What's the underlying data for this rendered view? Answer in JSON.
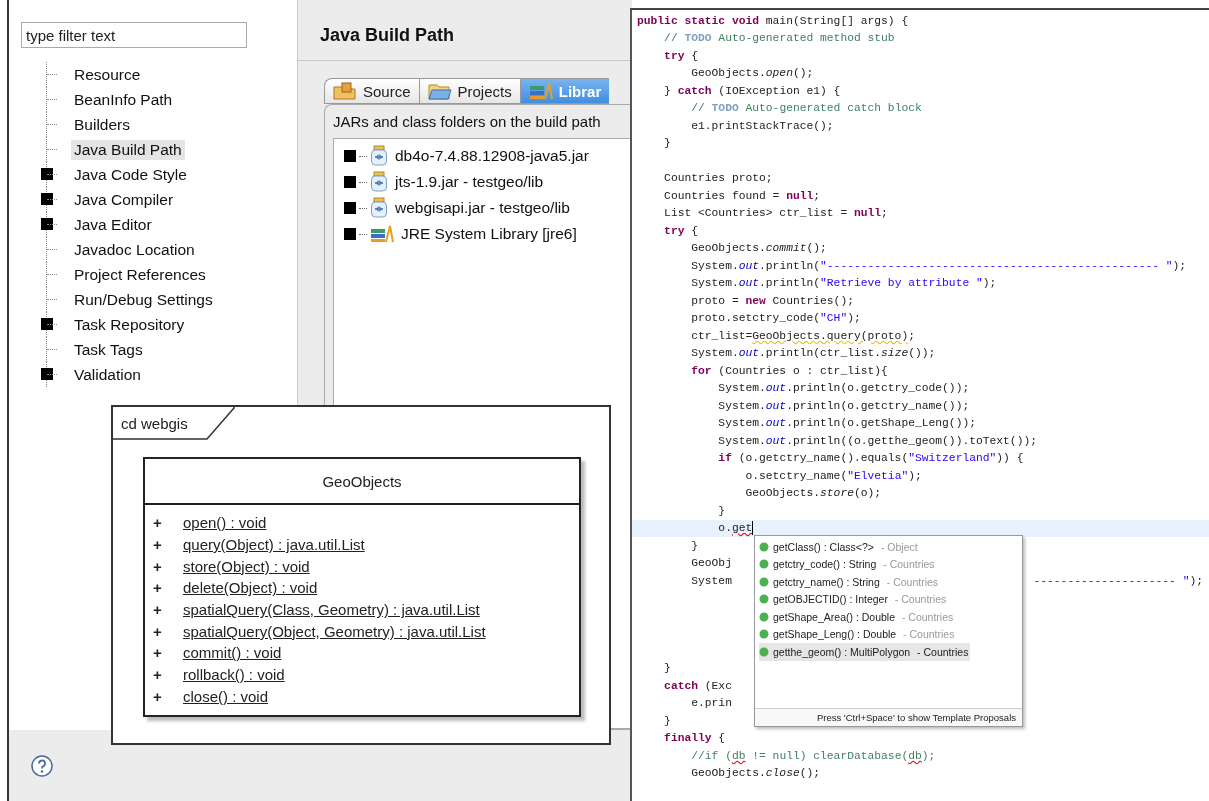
{
  "preferences": {
    "filter": {
      "placeholder": "type filter text"
    },
    "tree": [
      {
        "label": "Resource",
        "kind": "leaf",
        "selected": false
      },
      {
        "label": "BeanInfo Path",
        "kind": "leaf",
        "selected": false
      },
      {
        "label": "Builders",
        "kind": "leaf",
        "selected": false
      },
      {
        "label": "Java Build Path",
        "kind": "leaf",
        "selected": true
      },
      {
        "label": "Java Code Style",
        "kind": "folder",
        "selected": false
      },
      {
        "label": "Java Compiler",
        "kind": "folder",
        "selected": false
      },
      {
        "label": "Java Editor",
        "kind": "folder",
        "selected": false
      },
      {
        "label": "Javadoc Location",
        "kind": "leaf",
        "selected": false
      },
      {
        "label": "Project References",
        "kind": "leaf",
        "selected": false
      },
      {
        "label": "Run/Debug Settings",
        "kind": "leaf",
        "selected": false
      },
      {
        "label": "Task Repository",
        "kind": "folder",
        "selected": false
      },
      {
        "label": "Task Tags",
        "kind": "leaf",
        "selected": false
      },
      {
        "label": "Validation",
        "kind": "folder",
        "selected": false
      }
    ]
  },
  "build_path": {
    "title": "Java Build Path",
    "tabs": [
      {
        "label": "Source",
        "kind": "source",
        "selected": false
      },
      {
        "label": "Projects",
        "kind": "projects",
        "selected": false
      },
      {
        "label": "Librar",
        "kind": "libraries",
        "selected": true
      }
    ],
    "caption": "JARs and class folders on the build path",
    "entries": [
      {
        "label": "db4o-7.4.88.12908-java5.jar",
        "kind": "jar"
      },
      {
        "label": "jts-1.9.jar - testgeo/lib",
        "kind": "jar"
      },
      {
        "label": "webgisapi.jar - testgeo/lib",
        "kind": "jar"
      },
      {
        "label": "JRE System Library [jre6]",
        "kind": "library"
      }
    ]
  },
  "diagram": {
    "frame_label": "cd webgis",
    "class_name": "GeoObjects",
    "methods": [
      {
        "visibility": "+",
        "signature": "open() : void"
      },
      {
        "visibility": "+",
        "signature": "query(Object) : java.util.List"
      },
      {
        "visibility": "+",
        "signature": "store(Object) : void"
      },
      {
        "visibility": "+",
        "signature": "delete(Object) : void"
      },
      {
        "visibility": "+",
        "signature": "spatialQuery(Class, Geometry) : java.util.List"
      },
      {
        "visibility": "+",
        "signature": "spatialQuery(Object, Geometry) : java.util.List"
      },
      {
        "visibility": "+",
        "signature": "commit() : void"
      },
      {
        "visibility": "+",
        "signature": "rollback() : void"
      },
      {
        "visibility": "+",
        "signature": "close() : void"
      }
    ]
  },
  "editor": {
    "lines": [
      {
        "current": false,
        "parts": [
          {
            "kind": "keyword",
            "text": "public static void"
          },
          {
            "kind": "plain",
            "text": " main(String[] args) {"
          }
        ]
      },
      {
        "current": false,
        "parts": [
          {
            "kind": "comment",
            "text": "    // "
          },
          {
            "kind": "todo",
            "text": "TODO"
          },
          {
            "kind": "comment",
            "text": " Auto-generated method stub"
          }
        ]
      },
      {
        "current": false,
        "parts": [
          {
            "kind": "keyword",
            "text": "    try"
          },
          {
            "kind": "plain",
            "text": " {"
          }
        ]
      },
      {
        "current": false,
        "parts": [
          {
            "kind": "plain",
            "text": "        GeoObjects."
          },
          {
            "kind": "static",
            "text": "open"
          },
          {
            "kind": "plain",
            "text": "();"
          }
        ]
      },
      {
        "current": false,
        "parts": [
          {
            "kind": "plain",
            "text": "    } "
          },
          {
            "kind": "keyword",
            "text": "catch"
          },
          {
            "kind": "plain",
            "text": " (IOException e1) {"
          }
        ]
      },
      {
        "current": false,
        "parts": [
          {
            "kind": "comment",
            "text": "        // "
          },
          {
            "kind": "todo",
            "text": "TODO"
          },
          {
            "kind": "comment",
            "text": " Auto-generated catch block"
          }
        ]
      },
      {
        "current": false,
        "parts": [
          {
            "kind": "plain",
            "text": "        e1.printStackTrace();"
          }
        ]
      },
      {
        "current": false,
        "parts": [
          {
            "kind": "plain",
            "text": "    }"
          }
        ]
      },
      {
        "current": false
      },
      {
        "current": false,
        "parts": [
          {
            "kind": "plain",
            "text": "    Countries proto;"
          }
        ]
      },
      {
        "current": false,
        "parts": [
          {
            "kind": "plain",
            "text": "    Countries found = "
          },
          {
            "kind": "keyword",
            "text": "null"
          },
          {
            "kind": "plain",
            "text": ";"
          }
        ]
      },
      {
        "current": false,
        "parts": [
          {
            "kind": "plain",
            "text": "    List <Countries> ctr_list = "
          },
          {
            "kind": "keyword",
            "text": "null"
          },
          {
            "kind": "plain",
            "text": ";"
          }
        ]
      },
      {
        "current": false,
        "parts": [
          {
            "kind": "keyword",
            "text": "    try"
          },
          {
            "kind": "plain",
            "text": " {"
          }
        ]
      },
      {
        "current": false,
        "parts": [
          {
            "kind": "plain",
            "text": "        GeoObjects."
          },
          {
            "kind": "static",
            "text": "commit"
          },
          {
            "kind": "plain",
            "text": "();"
          }
        ]
      },
      {
        "current": false,
        "parts": [
          {
            "kind": "plain",
            "text": "        System."
          },
          {
            "kind": "field",
            "text": "out"
          },
          {
            "kind": "plain",
            "text": ".println("
          },
          {
            "kind": "string",
            "text": "\"------------------------------------------------- \""
          },
          {
            "kind": "plain",
            "text": ");"
          }
        ]
      },
      {
        "current": false,
        "parts": [
          {
            "kind": "plain",
            "text": "        System."
          },
          {
            "kind": "field",
            "text": "out"
          },
          {
            "kind": "plain",
            "text": ".println("
          },
          {
            "kind": "string",
            "text": "\"Retrieve by attribute \""
          },
          {
            "kind": "plain",
            "text": ");"
          }
        ]
      },
      {
        "current": false,
        "parts": [
          {
            "kind": "plain",
            "text": "        proto = "
          },
          {
            "kind": "keyword",
            "text": "new"
          },
          {
            "kind": "plain",
            "text": " Countries();"
          }
        ]
      },
      {
        "current": false,
        "parts": [
          {
            "kind": "plain",
            "text": "        proto.setctry_code("
          },
          {
            "kind": "string",
            "text": "\"CH\""
          },
          {
            "kind": "plain",
            "text": ");"
          }
        ]
      },
      {
        "current": false,
        "parts": [
          {
            "kind": "plain",
            "text": "        ctr_list="
          },
          {
            "kind": "warning",
            "text": "GeoObjects.query(proto)"
          },
          {
            "kind": "plain",
            "text": ";"
          }
        ]
      },
      {
        "current": false,
        "parts": [
          {
            "kind": "plain",
            "text": "        System."
          },
          {
            "kind": "field",
            "text": "out"
          },
          {
            "kind": "plain",
            "text": ".println(ctr_list."
          },
          {
            "kind": "static",
            "text": "size"
          },
          {
            "kind": "plain",
            "text": "());"
          }
        ]
      },
      {
        "current": false,
        "parts": [
          {
            "kind": "keyword",
            "text": "        for"
          },
          {
            "kind": "plain",
            "text": " (Countries o : ctr_list){"
          }
        ]
      },
      {
        "current": false,
        "parts": [
          {
            "kind": "plain",
            "text": "            System."
          },
          {
            "kind": "field",
            "text": "out"
          },
          {
            "kind": "plain",
            "text": ".println(o.getctry_code());"
          }
        ]
      },
      {
        "current": false,
        "parts": [
          {
            "kind": "plain",
            "text": "            System."
          },
          {
            "kind": "field",
            "text": "out"
          },
          {
            "kind": "plain",
            "text": ".println(o.getctry_name());"
          }
        ]
      },
      {
        "current": false,
        "parts": [
          {
            "kind": "plain",
            "text": "            System."
          },
          {
            "kind": "field",
            "text": "out"
          },
          {
            "kind": "plain",
            "text": ".println(o.getShape_Leng());"
          }
        ]
      },
      {
        "current": false,
        "parts": [
          {
            "kind": "plain",
            "text": "            System."
          },
          {
            "kind": "field",
            "text": "out"
          },
          {
            "kind": "plain",
            "text": ".println((o.getthe_geom()).toText());"
          }
        ]
      },
      {
        "current": false,
        "parts": [
          {
            "kind": "keyword",
            "text": "            if"
          },
          {
            "kind": "plain",
            "text": " (o.getctry_name().equals("
          },
          {
            "kind": "string",
            "text": "\"Switzerland\""
          },
          {
            "kind": "plain",
            "text": ")) {"
          }
        ]
      },
      {
        "current": false,
        "parts": [
          {
            "kind": "plain",
            "text": "                o.setctry_name("
          },
          {
            "kind": "string",
            "text": "\"Elvetia\""
          },
          {
            "kind": "plain",
            "text": ");"
          }
        ]
      },
      {
        "current": false,
        "parts": [
          {
            "kind": "plain",
            "text": "                GeoObjects."
          },
          {
            "kind": "static",
            "text": "store"
          },
          {
            "kind": "plain",
            "text": "(o);"
          }
        ]
      },
      {
        "current": false,
        "parts": [
          {
            "kind": "plain",
            "text": "            }"
          }
        ]
      },
      {
        "current": true,
        "parts": [
          {
            "kind": "plain",
            "text": "            o."
          },
          {
            "kind": "error",
            "text": "get"
          }
        ]
      },
      {
        "current": false,
        "parts": [
          {
            "kind": "plain",
            "text": "        }"
          }
        ]
      },
      {
        "current": false,
        "parts": [
          {
            "kind": "plain",
            "text": "        GeoObj"
          }
        ]
      },
      {
        "current": false,
        "parts": [
          {
            "kind": "plain",
            "text": "        System"
          }
        ],
        "tail": [
          {
            "kind": "string",
            "text": "--------------------- \""
          },
          {
            "kind": "plain",
            "text": ");"
          }
        ]
      },
      {
        "current": false
      },
      {
        "current": false
      },
      {
        "current": false
      },
      {
        "current": false
      },
      {
        "current": false,
        "parts": [
          {
            "kind": "plain",
            "text": "    }"
          }
        ]
      },
      {
        "current": false,
        "parts": [
          {
            "kind": "keyword",
            "text": "    catch"
          },
          {
            "kind": "plain",
            "text": " (Exc"
          }
        ]
      },
      {
        "current": false,
        "parts": [
          {
            "kind": "plain",
            "text": "        e.prin"
          }
        ]
      },
      {
        "current": false,
        "parts": [
          {
            "kind": "plain",
            "text": "    }"
          }
        ]
      },
      {
        "current": false,
        "parts": [
          {
            "kind": "keyword",
            "text": "    finally"
          },
          {
            "kind": "plain",
            "text": " {"
          }
        ]
      },
      {
        "current": false,
        "parts": [
          {
            "kind": "comment",
            "text": "        //if ("
          },
          {
            "kind": "comment_error",
            "text": "db"
          },
          {
            "kind": "comment",
            "text": " != null) clearDatabase("
          },
          {
            "kind": "comment_error",
            "text": "db"
          },
          {
            "kind": "comment",
            "text": ");"
          }
        ]
      },
      {
        "current": false,
        "parts": [
          {
            "kind": "plain",
            "text": "        GeoObjects."
          },
          {
            "kind": "static",
            "text": "close"
          },
          {
            "kind": "plain",
            "text": "();"
          }
        ]
      }
    ],
    "completion": {
      "proposals": [
        {
          "signature": "getClass() : Class<?>",
          "owner": " - Object",
          "selected": false
        },
        {
          "signature": "getctry_code() : String",
          "owner": " - Countries",
          "selected": false
        },
        {
          "signature": "getctry_name() : String",
          "owner": " - Countries",
          "selected": false
        },
        {
          "signature": "getOBJECTID() : Integer",
          "owner": " - Countries",
          "selected": false
        },
        {
          "signature": "getShape_Area() : Double",
          "owner": " - Countries",
          "selected": false
        },
        {
          "signature": "getShape_Leng() : Double",
          "owner": " - Countries",
          "selected": false
        },
        {
          "signature": "getthe_geom() : MultiPolygon",
          "owner": " - Countries",
          "selected": true
        }
      ],
      "hint": "Press 'Ctrl+Space' to show Template Proposals"
    }
  }
}
